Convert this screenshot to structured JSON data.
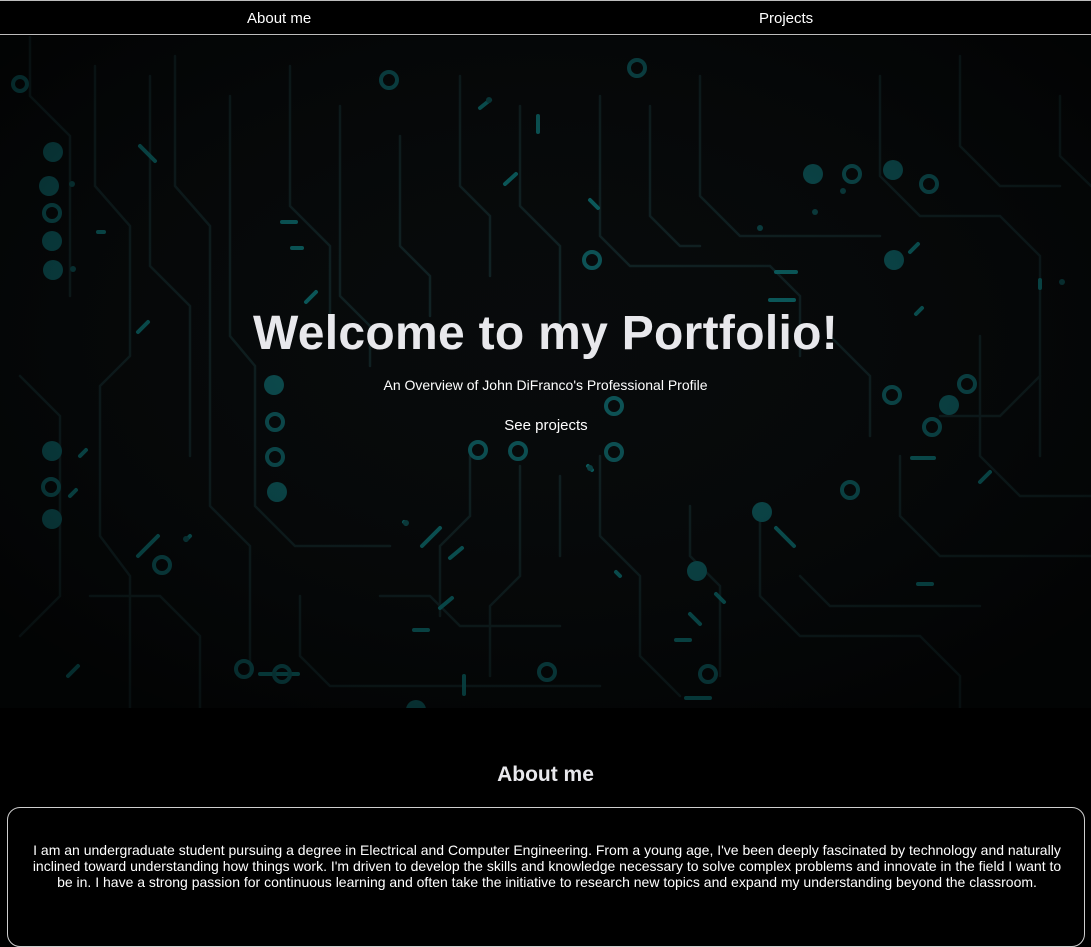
{
  "nav": {
    "about_label": "About me",
    "projects_label": "Projects"
  },
  "hero": {
    "title": "Welcome to my Portfolio!",
    "subtitle": "An Overview of John DiFranco's Professional Profile",
    "cta_label": "See projects",
    "background": "circuit-board-pattern"
  },
  "about": {
    "heading": "About me",
    "body": "I am an undergraduate student pursuing a degree in Electrical and Computer Engineering. From a young age, I've been deeply fascinated by technology and naturally inclined toward understanding how things work. I'm driven to develop the skills and knowledge necessary to solve complex problems and innovate in the field I want to be in. I have a strong passion for continuous learning and often take the initiative to research new topics and expand my understanding beyond the classroom."
  },
  "colors": {
    "background": "#000000",
    "accent": "#0fb8b8",
    "trace": "#123a3c",
    "text": "#ffffff"
  }
}
